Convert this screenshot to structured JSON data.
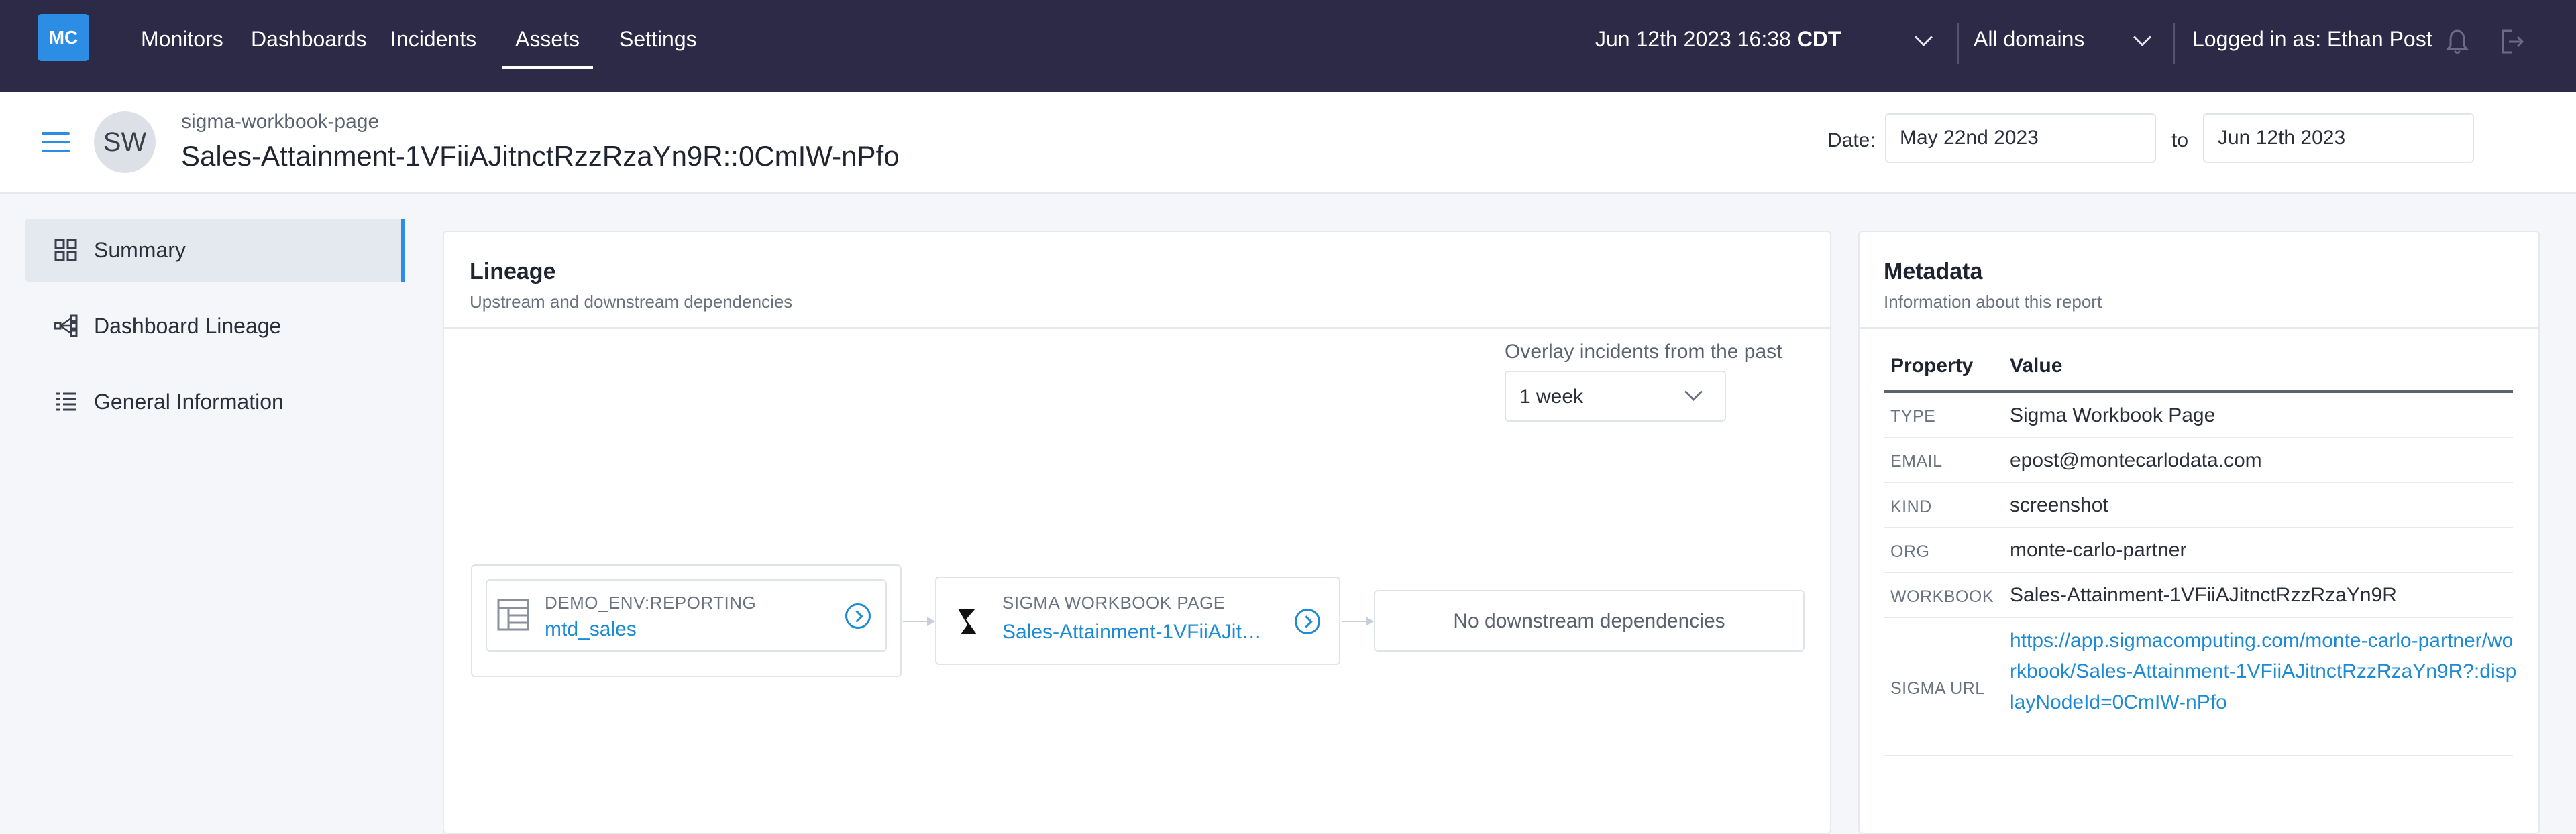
{
  "app": {
    "logo": "MC",
    "nav": [
      "Monitors",
      "Dashboards",
      "Incidents",
      "Assets",
      "Settings"
    ],
    "active_nav": "Assets",
    "datetime": "Jun 12th 2023 16:38",
    "timezone": "CDT",
    "domain_select": "All domains",
    "logged_in": "Logged in as: Ethan Post",
    "icons": [
      "chevron-down-icon",
      "bell-icon",
      "logout-icon"
    ]
  },
  "header": {
    "menu_icon": "hamburger-icon",
    "avatar": "SW",
    "subtitle": "sigma-workbook-page",
    "title": "Sales-Attainment-1VFiiAJitnctRzzRzaYn9R::0CmIW-nPfo",
    "date_label": "Date:",
    "date_from": "May 22nd 2023",
    "to_label": "to",
    "date_to": "Jun 12th 2023"
  },
  "sidebar": {
    "items": [
      {
        "label": "Summary",
        "icon": "grid-icon",
        "active": true
      },
      {
        "label": "Dashboard Lineage",
        "icon": "lineage-icon",
        "active": false
      },
      {
        "label": "General Information",
        "icon": "list-icon",
        "active": false
      }
    ]
  },
  "lineage": {
    "title": "Lineage",
    "description": "Upstream and downstream dependencies",
    "overlay_label": "Overlay incidents from the past",
    "overlay_value": "1 week",
    "upstream": {
      "type": "DEMO_ENV:REPORTING",
      "name": "mtd_sales",
      "icon": "table-icon"
    },
    "current": {
      "type": "SIGMA WORKBOOK PAGE",
      "name": "Sales-Attainment-1VFiiAJit…",
      "icon": "sigma-icon"
    },
    "downstream_empty": "No downstream dependencies"
  },
  "metadata": {
    "title": "Metadata",
    "description": "Information about this report",
    "columns": [
      "Property",
      "Value"
    ],
    "rows": [
      {
        "property": "TYPE",
        "value": "Sigma Workbook Page"
      },
      {
        "property": "EMAIL",
        "value": "epost@montecarlodata.com"
      },
      {
        "property": "KIND",
        "value": "screenshot"
      },
      {
        "property": "ORG",
        "value": "monte-carlo-partner"
      },
      {
        "property": "WORKBOOK",
        "value": "Sales-Attainment-1VFiiAJitnctRzzRzaYn9R"
      },
      {
        "property": "SIGMA URL",
        "value": "https://app.sigmacomputing.com/monte-carlo-partner/workbook/Sales-Attainment-1VFiiAJitnctRzzRzaYn9R?:displayNodeId=0CmIW-nPfo"
      }
    ]
  },
  "colors": {
    "nav_bg": "#2d2a47",
    "accent": "#2b8de3",
    "link": "#1d8ad6"
  }
}
